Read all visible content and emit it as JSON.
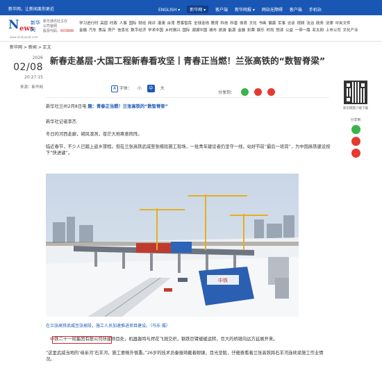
{
  "topbar": {
    "slogan": "新华网，让新闻离你更近",
    "menu": [
      "ENGLISH ▾",
      "新华网 ▾",
      "客户端",
      "新华网报 ▾",
      "网站无障碍",
      "客户端",
      "手机站"
    ],
    "colors": {
      "bar": "#1a57b4"
    }
  },
  "header": {
    "logo_text": "新华网",
    "logo_cn": "新华",
    "logo_en": "News",
    "logo_url": "www.xinhuanet.com",
    "brand_line1": "新华通讯社主办",
    "brand_line2": "公司官网",
    "brand_line3_label": "股票代码：",
    "brand_line3_code": "603888",
    "nav_line1": "学习进行时 高层 时政 人事 国际 财经 网评 港澳 台湾 思客智库 全球连线 教育 科技 科普 体育 文化 书画 健康 军事 访谈 视频 法治 政务 法律 中央文件",
    "nav_line2": "金融 汽车 食品 房产 信息化 数字经济 学术中国 乡村振兴 国际 湖湖中国 城市 旅游 能源 金融 彩票 娱乐 时尚 悦读 公益 一带一路 亚太网 上市公司 文化产业"
  },
  "breadcrumb": "新华网 > 新闻 > 正文",
  "date": {
    "year": "2026",
    "monthday": "02/08",
    "time": "20:27:15",
    "source": "来源：新华网"
  },
  "title": "新春走基层·大国工程新春看攻坚丨青春正当燃！兰张高铁的“数智脊梁”",
  "tools": {
    "font_label": "字体：",
    "sizes": [
      "小",
      "中",
      "大"
    ],
    "share_label": "分享到："
  },
  "article": {
    "dateline": "新华社兰州2月8日电 ",
    "headline_label": "题：",
    "headline": "青春正当燃！兰张高铁的“数智脊梁”",
    "byline": "新华社记者李杰",
    "p1": "冬日的河西走廊，朔风凛冽，苍茫大地寒意阵阵。",
    "p2": "临近春节，不少人已踏上返乡旅程。但在兰张高铁武威至张掖段施工现场，一批青年建设者仍坚守一线，站好节前“最后一班岗”，为中国高铁建设按下“快进键”。",
    "caption": "在兰张高铁武威至张掖段，施工人员加速推进项目建设。（马乐 摄）",
    "p3_company": "中铁二十一局集团有限公司",
    "p3_rest": "所建项目处，机器轰鸣与焊花飞溅交织，钢铁巨臂缓缓运转，巨大的桥墩向远方延展开来。",
    "p4": "“这里武威当地的‘母亲河’石羊河，施工要格外慎重。”26岁的技术员秦振琦戴着眼镜，目光坚毅，仔细查看着兰张高铁跨石羊河连续梁施工作业情况。"
  },
  "photo": {
    "sign_title": "中铁",
    "sign_text": "中铁二十一局"
  },
  "rail": {
    "qr_label": "新华网客户端下载",
    "share_label": "分享到"
  }
}
